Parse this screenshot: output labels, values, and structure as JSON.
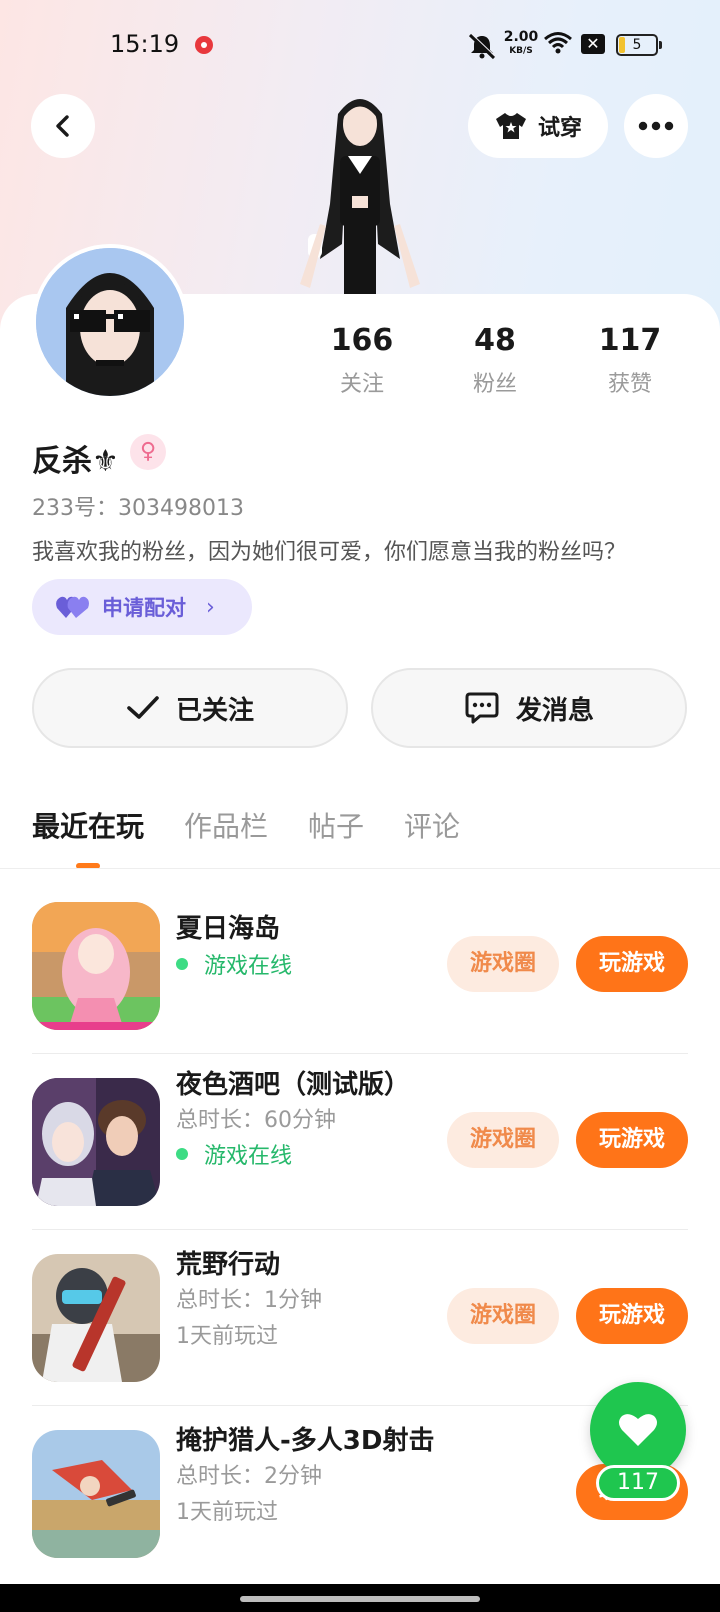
{
  "status_bar": {
    "time": "15:19",
    "speed_value": "2.00",
    "speed_unit": "KB/S",
    "battery": "5"
  },
  "header": {
    "try_on_label": "试穿"
  },
  "profile": {
    "username": "反杀⚜",
    "gender_symbol": "♀",
    "id_text": "233号：303498013",
    "bio": "我喜欢我的粉丝，因为她们很可爱，你们愿意当我的粉丝吗？",
    "stats": [
      {
        "value": "166",
        "label": "关注"
      },
      {
        "value": "48",
        "label": "粉丝"
      },
      {
        "value": "117",
        "label": "获赞"
      }
    ],
    "pair_label": "申请配对",
    "follow_label": "已关注",
    "message_label": "发消息"
  },
  "tabs": [
    "最近在玩",
    "作品栏",
    "帖子",
    "评论"
  ],
  "games": [
    {
      "name": "夏日海岛",
      "duration": "",
      "status": "游戏在线",
      "last_played": "",
      "circle_label": "游戏圈",
      "play_label": "玩游戏"
    },
    {
      "name": "夜色酒吧（测试版）",
      "duration": "总时长：60分钟",
      "status": "游戏在线",
      "last_played": "",
      "circle_label": "游戏圈",
      "play_label": "玩游戏"
    },
    {
      "name": "荒野行动",
      "duration": "总时长：1分钟",
      "status": "",
      "last_played": "1天前玩过",
      "circle_label": "游戏圈",
      "play_label": "玩游戏"
    },
    {
      "name": "掩护猎人-多人3D射击",
      "duration": "总时长：2分钟",
      "status": "",
      "last_played": "1天前玩过",
      "circle_label": "",
      "play_label": "玩游戏"
    }
  ],
  "fab": {
    "like_count": "117"
  },
  "colors": {
    "accent_orange": "#ff7418",
    "online_green": "#26b86b",
    "like_green": "#1fc64f",
    "pair_purple": "#6a5ed8"
  }
}
